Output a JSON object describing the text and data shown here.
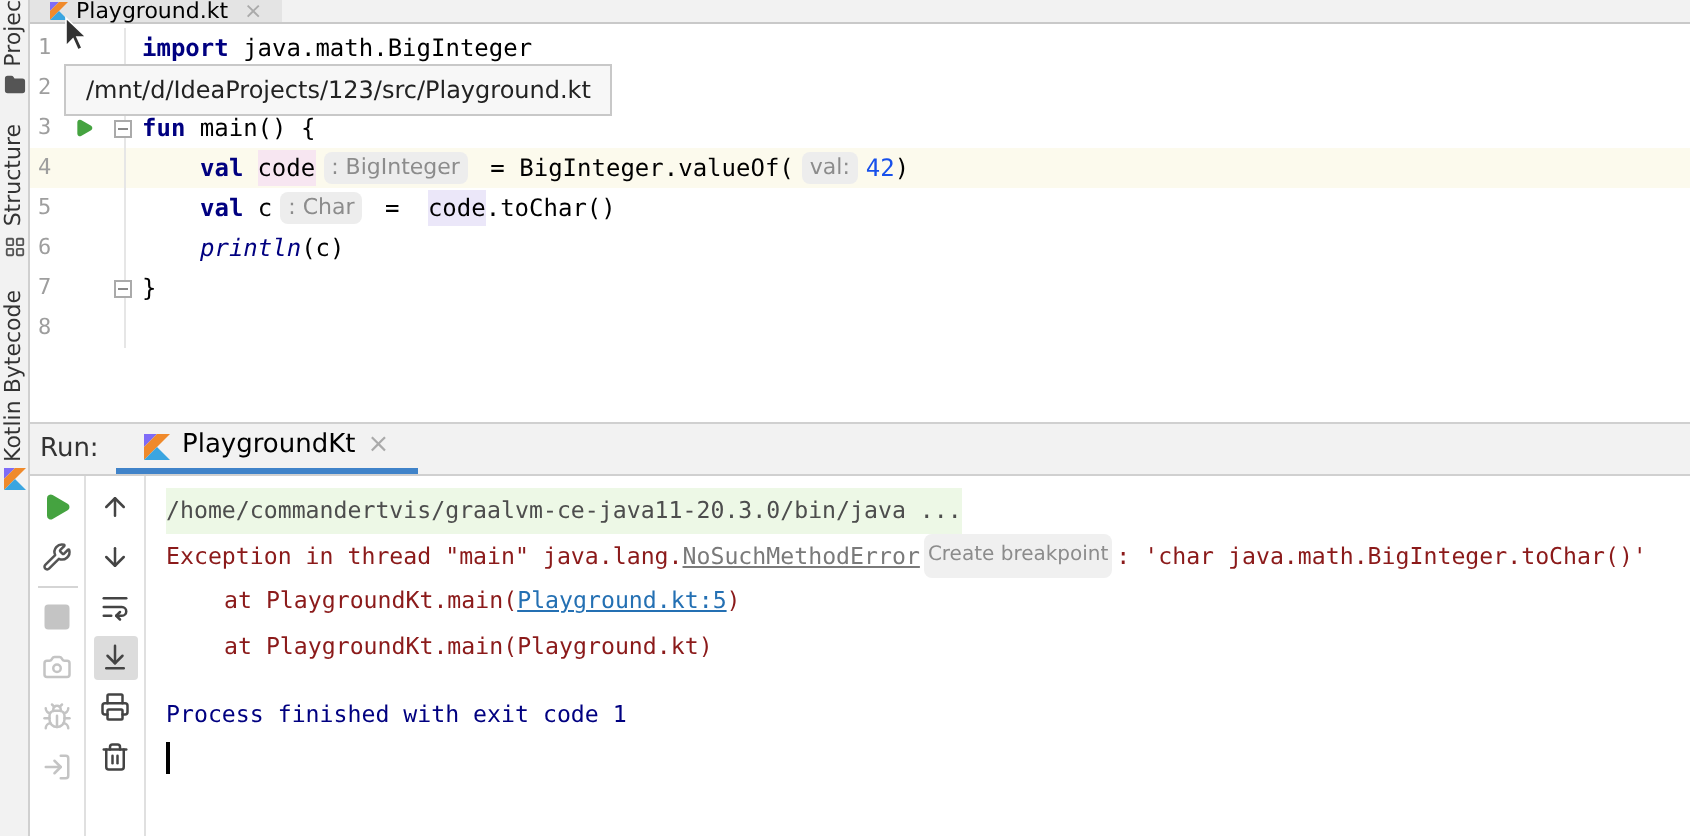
{
  "side_tabs": [
    {
      "label": "Projec"
    },
    {
      "label": "Structure"
    },
    {
      "label": "Kotlin Bytecode"
    }
  ],
  "editor_tab": {
    "label": "Playground.kt",
    "close": "×",
    "selected": true
  },
  "tooltip": "/mnt/d/IdeaProjects/123/src/Playground.kt",
  "code_lines": [
    {
      "number": "1",
      "current": false,
      "runnable": false,
      "fold": false,
      "indented": false,
      "tokens": [
        {
          "kind": "keyword",
          "text": "import"
        },
        {
          "kind": "text",
          "text": " java.math.BigInteger"
        }
      ]
    },
    {
      "number": "2",
      "current": false,
      "runnable": false,
      "fold": false,
      "indented": false
    },
    {
      "number": "3",
      "current": false,
      "runnable": true,
      "fold": true,
      "indented": false,
      "tokens": [
        {
          "kind": "keyword",
          "text": "fun"
        },
        {
          "kind": "text",
          "text": " main() {"
        }
      ]
    },
    {
      "number": "4",
      "current": true,
      "runnable": false,
      "fold": false,
      "indented": true,
      "tokens": [
        {
          "kind": "keyword",
          "text": "val"
        },
        {
          "kind": "highlight",
          "text": "code",
          "color": "#f7e6f1"
        },
        {
          "kind": "hint",
          "text": ": BigInteger"
        },
        {
          "kind": "text",
          "text": " = BigInteger.valueOf("
        },
        {
          "kind": "hint",
          "text": "val:"
        },
        {
          "kind": "number",
          "text": "42"
        },
        {
          "kind": "text",
          "text": ")"
        }
      ]
    },
    {
      "number": "5",
      "current": false,
      "runnable": false,
      "fold": false,
      "indented": true,
      "tokens": [
        {
          "kind": "keyword",
          "text": "val"
        },
        {
          "kind": "text",
          "text": " c"
        },
        {
          "kind": "hint",
          "text": ": Char"
        },
        {
          "kind": "text",
          "text": " = "
        },
        {
          "kind": "highlight",
          "text": "code",
          "color": "#ebe7f9"
        },
        {
          "kind": "text",
          "text": ".toChar()"
        }
      ]
    },
    {
      "number": "6",
      "current": false,
      "runnable": false,
      "fold": false,
      "indented": true,
      "tokens": [
        {
          "kind": "call",
          "text": "println"
        },
        {
          "kind": "text",
          "text": "(c)"
        }
      ]
    },
    {
      "number": "7",
      "current": false,
      "runnable": false,
      "fold": true,
      "indented": false,
      "tokens": [
        {
          "kind": "text",
          "text": "}"
        }
      ]
    },
    {
      "number": "8",
      "current": false,
      "runnable": false,
      "fold": false,
      "indented": false
    }
  ],
  "run_panel": {
    "title": "Run:",
    "tab": {
      "label": "PlaygroundKt",
      "close": "×",
      "selected": true
    },
    "left_tools": [
      {
        "disabled": false
      },
      {
        "disabled": false
      },
      {
        "disabled": true
      },
      {
        "disabled": true
      },
      {
        "disabled": true
      },
      {
        "disabled": true
      }
    ],
    "right_tools": [
      {
        "selected": false
      },
      {
        "selected": false
      },
      {
        "selected": false
      },
      {
        "selected": true
      },
      {
        "selected": false
      },
      {
        "selected": false
      }
    ],
    "console": [
      {
        "indented": false,
        "gap_before": false,
        "tokens": [
          {
            "kind": "command",
            "text": "/home/commandertvis/graalvm-ce-java11-20.3.0/bin/java ..."
          }
        ]
      },
      {
        "indented": false,
        "gap_before": false,
        "tokens": [
          {
            "kind": "error",
            "text": "Exception in thread \"main\" java.lang."
          },
          {
            "kind": "error-link",
            "text": "NoSuchMethodError"
          },
          {
            "kind": "hint",
            "text": "Create breakpoint"
          },
          {
            "kind": "error",
            "text": ": 'char java.math.BigInteger.toChar()'"
          }
        ]
      },
      {
        "indented": true,
        "gap_before": false,
        "tokens": [
          {
            "kind": "error",
            "text": "at PlaygroundKt.main("
          },
          {
            "kind": "link",
            "text": "Playground.kt:5"
          },
          {
            "kind": "error",
            "text": ")"
          }
        ]
      },
      {
        "indented": true,
        "gap_before": false,
        "tokens": [
          {
            "kind": "error",
            "text": "at PlaygroundKt.main(Playground.kt)"
          }
        ]
      },
      {
        "indented": false,
        "gap_before": true,
        "tokens": [
          {
            "kind": "info",
            "text": "Process finished with exit code 1"
          }
        ]
      }
    ],
    "caret": true
  }
}
